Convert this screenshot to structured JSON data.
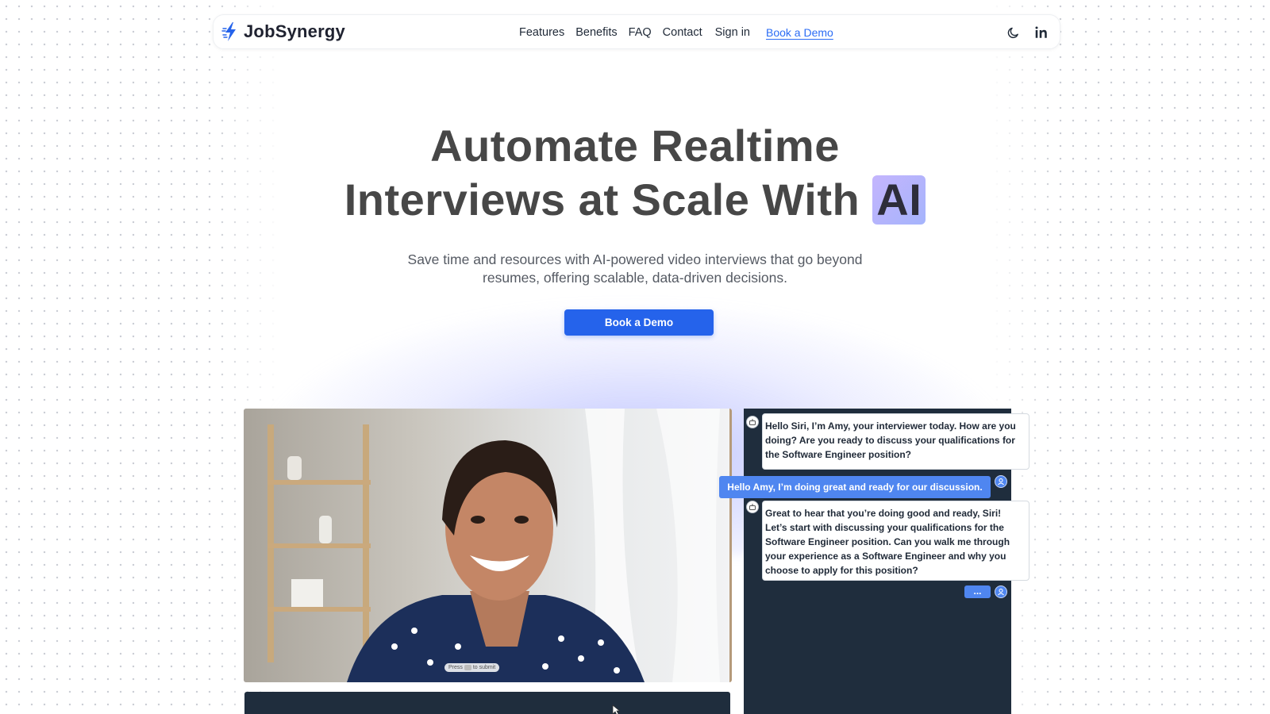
{
  "brand": {
    "name": "JobSynergy",
    "logo_icon": "lightning-bolt-icon",
    "logo_color": "#2563eb"
  },
  "nav": {
    "links": [
      "Features",
      "Benefits",
      "FAQ",
      "Contact"
    ],
    "sign_in": "Sign in",
    "book_demo": "Book a Demo",
    "icons": [
      "moon-icon",
      "linkedin-icon"
    ]
  },
  "hero": {
    "title_line1": "Automate Realtime",
    "title_line2_prefix": "Interviews at Scale With",
    "title_highlight": "AI",
    "subtitle": "Save time and resources with AI-powered video interviews that go beyond resumes, offering scalable, data-driven decisions.",
    "cta": "Book a Demo",
    "accent_color": "#2563eb",
    "highlight_gradient": [
      "#c4b5fd",
      "#a5b4fc"
    ]
  },
  "demo": {
    "video_hint": {
      "before": "Press",
      "after": "to submit"
    },
    "chat": [
      {
        "role": "bot",
        "text": "Hello Siri, I’m Amy, your interviewer today. How are you doing? Are you ready to discuss your qualifications for the Software Engineer position?"
      },
      {
        "role": "user",
        "text": "Hello Amy, I’m doing great and ready for our discussion."
      },
      {
        "role": "bot",
        "text": "Great to hear that you’re doing good and ready, Siri! Let’s start with discussing your qualifications for the Software Engineer position. Can you walk me through your experience as a Software Engineer and why you choose to apply for this position?"
      }
    ],
    "typing_indicator": "...",
    "panel_color": "#1f2d3d",
    "user_bubble_color": "#4f86f0"
  }
}
